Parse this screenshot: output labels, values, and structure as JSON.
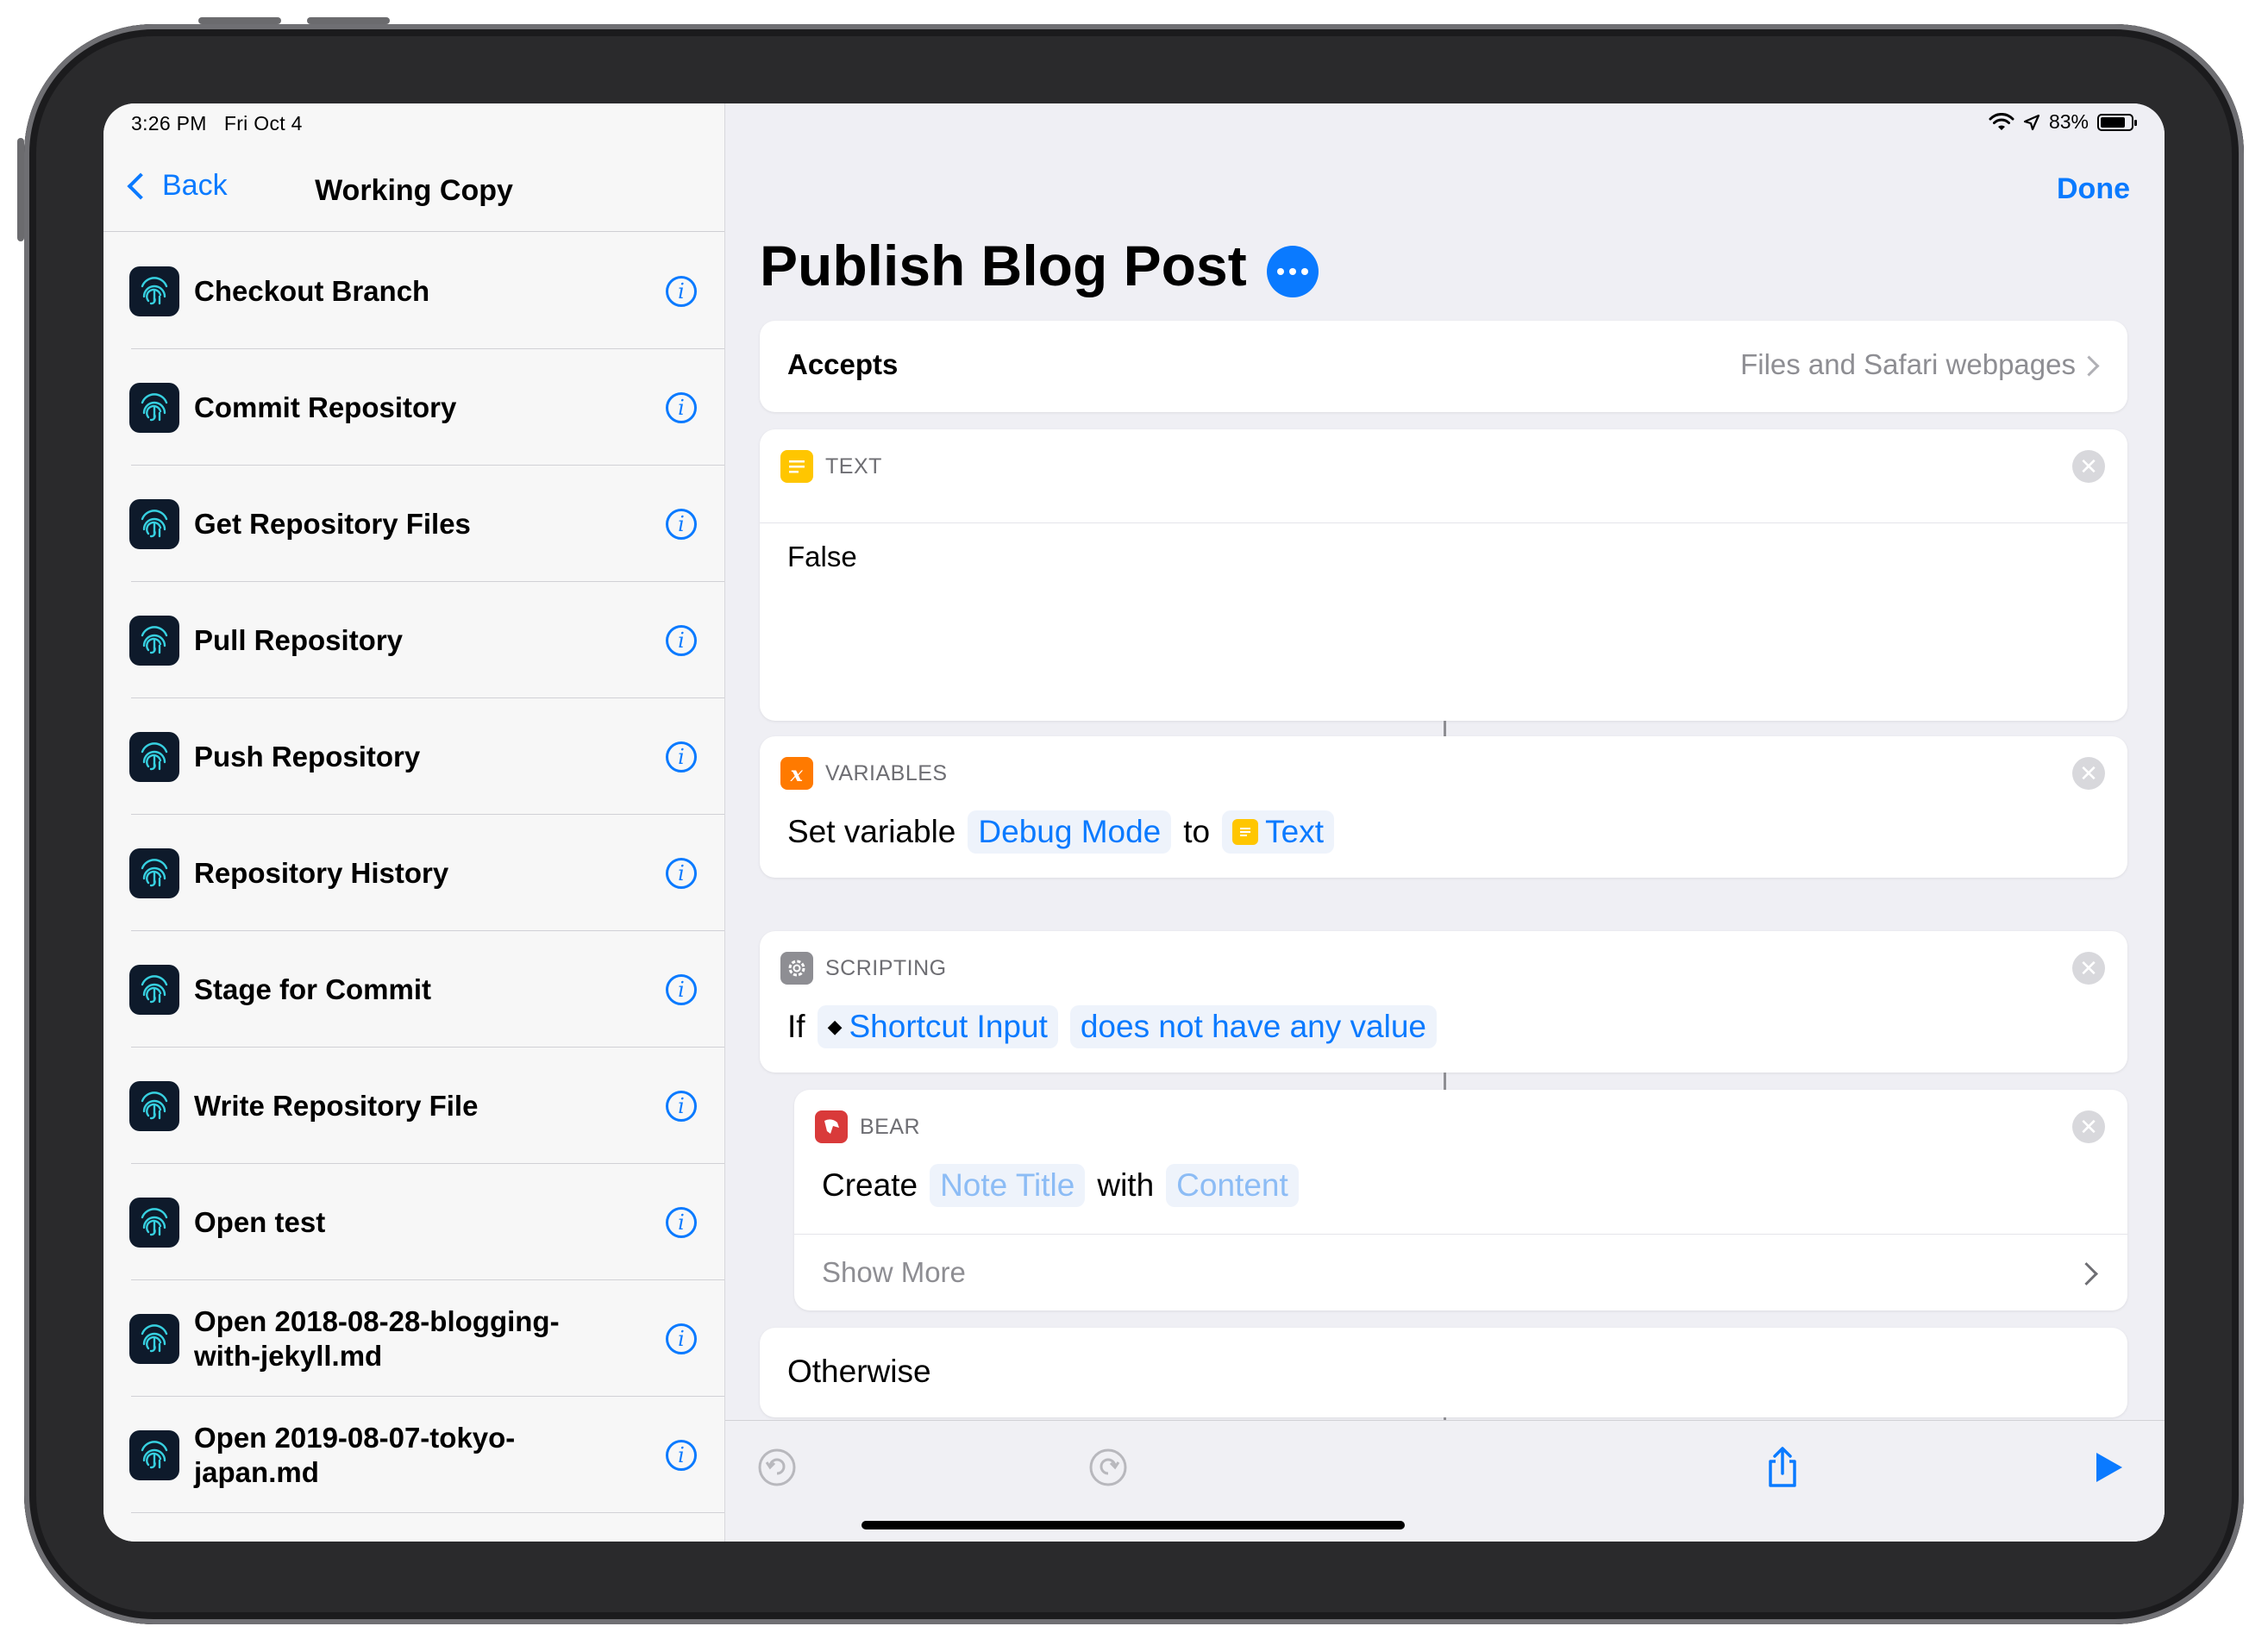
{
  "status_bar": {
    "time": "3:26 PM",
    "date": "Fri Oct 4",
    "battery_percent": "83%",
    "battery_level": 0.83,
    "icons": [
      "wifi-icon",
      "location-icon",
      "battery-icon"
    ]
  },
  "sidebar": {
    "back_label": "Back",
    "title": "Working Copy",
    "items": [
      {
        "label": "Checkout Branch"
      },
      {
        "label": "Commit Repository"
      },
      {
        "label": "Get Repository Files"
      },
      {
        "label": "Pull Repository"
      },
      {
        "label": "Push Repository"
      },
      {
        "label": "Repository History"
      },
      {
        "label": "Stage for Commit"
      },
      {
        "label": "Write Repository File"
      },
      {
        "label": "Open test"
      },
      {
        "label": "Open 2018-08-28-blogging-with-jekyll.md"
      },
      {
        "label": "Open 2019-08-07-tokyo-japan.md"
      }
    ]
  },
  "main": {
    "done_label": "Done",
    "title": "Publish Blog Post",
    "accepts": {
      "label": "Accepts",
      "value": "Files and Safari webpages"
    },
    "actions": {
      "text": {
        "category": "TEXT",
        "body": "False"
      },
      "variables": {
        "category": "VARIABLES",
        "prefix": "Set variable",
        "variable": "Debug Mode",
        "to_word": "to",
        "value": "Text"
      },
      "scripting": {
        "category": "SCRIPTING",
        "keyword": "If",
        "input": "Shortcut Input",
        "condition": "does not have any value"
      },
      "bear": {
        "category": "BEAR",
        "verb": "Create",
        "title_placeholder": "Note Title",
        "with_word": "with",
        "content_placeholder": "Content",
        "show_more": "Show More"
      },
      "otherwise": {
        "label": "Otherwise"
      }
    }
  },
  "colors": {
    "accent": "#0a7aff",
    "text_action": "#ffc600",
    "variables_action": "#ff7a00",
    "scripting_action": "#8e8e93",
    "bear_action": "#d93a3a"
  }
}
